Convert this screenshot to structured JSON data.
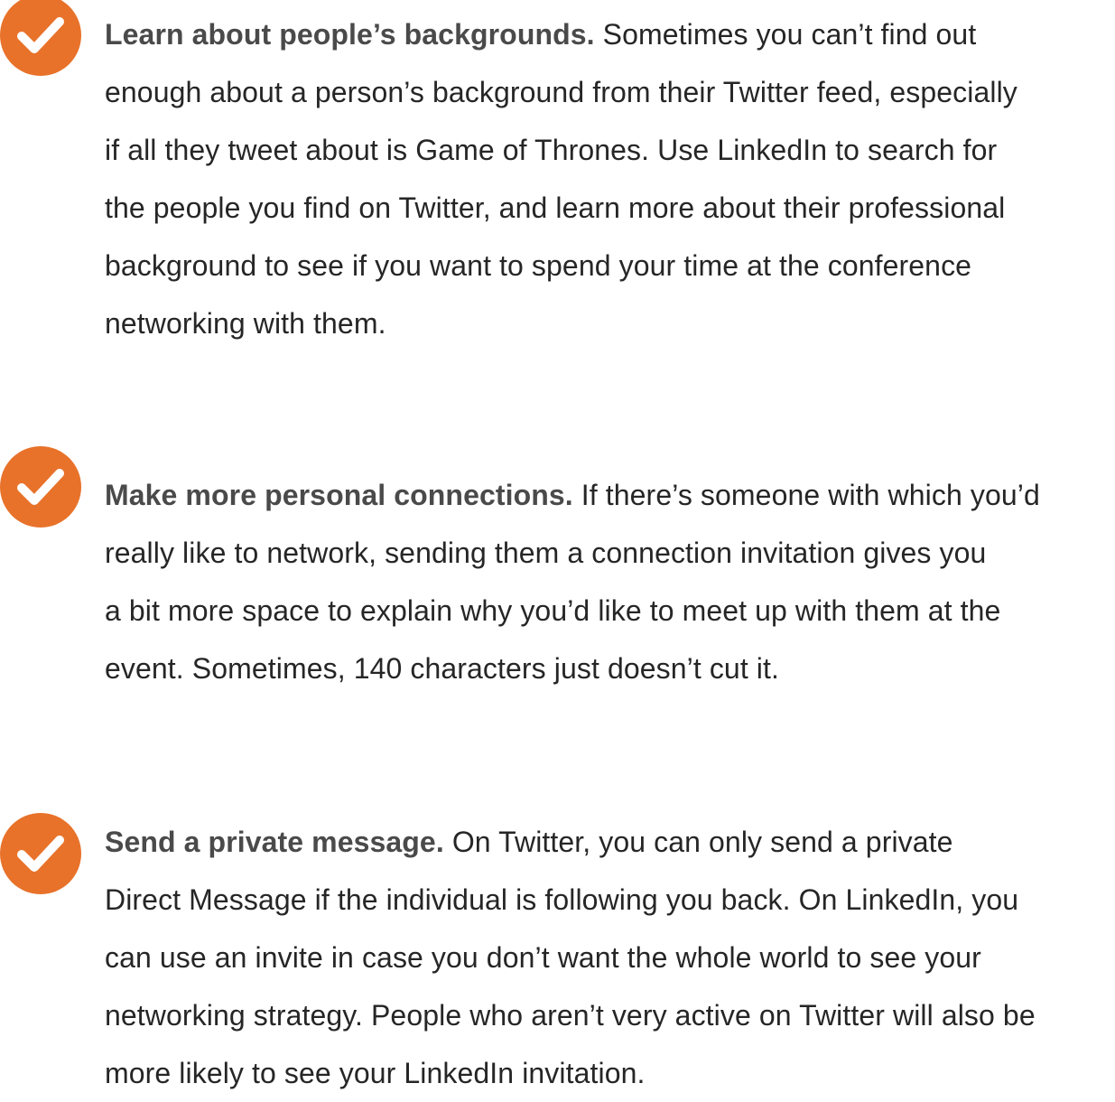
{
  "icon": {
    "name": "check-circle-icon",
    "color": "#e8722a"
  },
  "tips": [
    {
      "lead": "Learn about people’s backgrounds.",
      "lines": [
        " Sometimes you can’t find out",
        "enough about a person’s background from their Twitter feed, especially",
        "if all they tweet about is Game of Thrones. Use LinkedIn to search for",
        "the people you find on Twitter, and learn more about their professional",
        "background to see if you want to spend your time at the conference",
        "networking with them."
      ]
    },
    {
      "lead": "Make more personal connections.",
      "lines": [
        " If there’s someone with which you’d",
        "really like to network, sending them a connection invitation gives you",
        "a bit more space to explain why you’d like to meet up with them at the",
        "event. Sometimes, 140 characters just doesn’t cut it."
      ]
    },
    {
      "lead": "Send a private message.",
      "lines": [
        " On Twitter, you can only send a private",
        "Direct Message if the individual is following you back. On LinkedIn, you",
        "can use an invite in case you don’t want the whole world to see your",
        "networking strategy. People who aren’t very active on Twitter will also be",
        "more likely to see your LinkedIn invitation."
      ]
    }
  ]
}
